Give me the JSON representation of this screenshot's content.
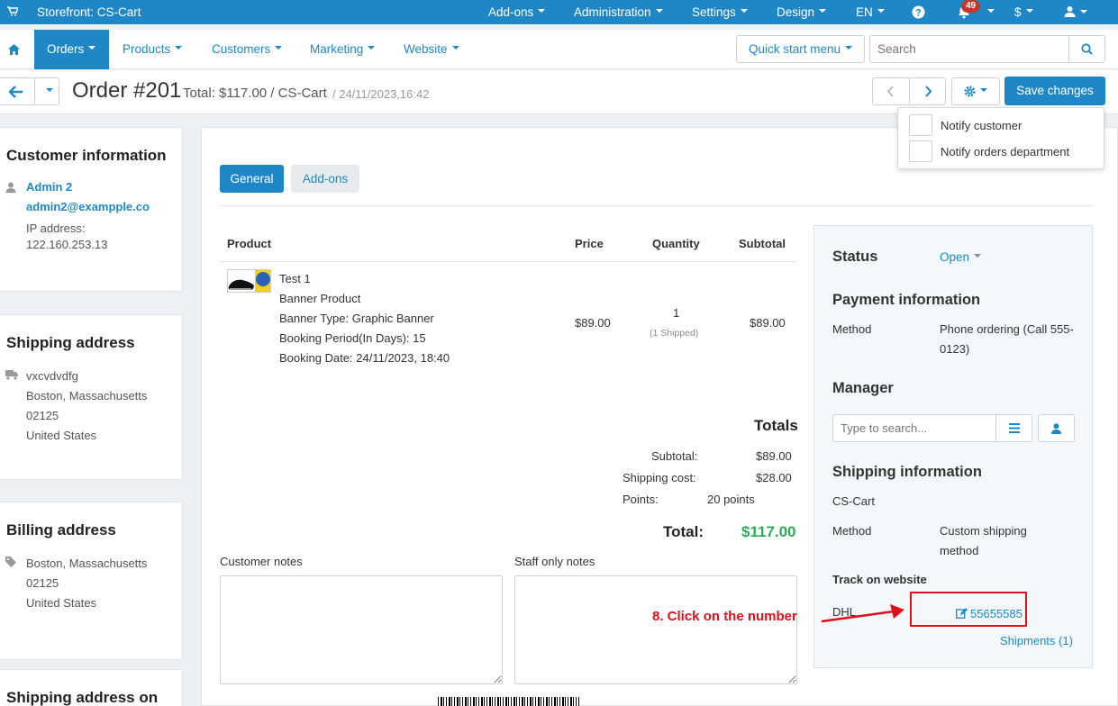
{
  "topbar": {
    "storefront": "Storefront: CS-Cart",
    "addons": "Add-ons",
    "administration": "Administration",
    "settings": "Settings",
    "design": "Design",
    "language": "EN",
    "notification_count": "49",
    "currency": "$"
  },
  "nav": {
    "orders": "Orders",
    "products": "Products",
    "customers": "Customers",
    "marketing": "Marketing",
    "website": "Website",
    "quick_start": "Quick start menu",
    "search_placeholder": "Search"
  },
  "header": {
    "title": "Order #201",
    "total": "Total: $117.00 / CS-Cart",
    "date": "/ 24/11/2023,16:42",
    "save": "Save changes"
  },
  "notify": {
    "customer": "Notify customer",
    "orders_dept": "Notify orders department"
  },
  "customer_info": {
    "heading": "Customer information",
    "name": "Admin 2",
    "email": "admin2@exampple.co",
    "ip_label": "IP address:",
    "ip": "122.160.253.13"
  },
  "shipping_address": {
    "heading": "Shipping address",
    "name": "vxcvdvdfg",
    "city": "Boston, Massachusetts",
    "zip": "02125",
    "country": "United States"
  },
  "billing_address": {
    "heading": "Billing address",
    "city": "Boston, Massachusetts",
    "zip": "02125",
    "country": "United States"
  },
  "shipping_address_on": {
    "heading": "Shipping address on"
  },
  "tabs": {
    "general": "General",
    "addons": "Add-ons"
  },
  "table": {
    "headers": {
      "product": "Product",
      "price": "Price",
      "quantity": "Quantity",
      "subtotal": "Subtotal"
    },
    "row": {
      "name": "Test 1",
      "type": "Banner Product",
      "banner_type": "Banner Type: Graphic Banner",
      "booking_period": "Booking Period(In Days): 15",
      "booking_date": "Booking Date: 24/11/2023, 18:40",
      "price": "$89.00",
      "qty": "1",
      "shipped": "(1 Shipped)",
      "subtotal": "$89.00"
    }
  },
  "totals": {
    "heading": "Totals",
    "subtotal_label": "Subtotal:",
    "subtotal": "$89.00",
    "shipping_label": "Shipping cost:",
    "shipping": "$28.00",
    "points_label": "Points:",
    "points": "20 points",
    "total_label": "Total:",
    "total": "$117.00"
  },
  "notes": {
    "customer": "Customer notes",
    "staff": "Staff only notes"
  },
  "side": {
    "status_label": "Status",
    "status": "Open",
    "payment_heading": "Payment information",
    "method_label": "Method",
    "payment_method": "Phone ordering (Call 555-0123)",
    "manager_heading": "Manager",
    "manager_placeholder": "Type to search...",
    "shipping_heading": "Shipping information",
    "shipping_store": "CS-Cart",
    "shipping_method_label": "Method",
    "shipping_method": "Custom shipping method",
    "track_heading": "Track on website",
    "carrier": "DHL",
    "tracking_number": "55655585",
    "shipments": "Shipments (1)"
  },
  "annotation": {
    "text": "8. Click on the number"
  },
  "colors": {
    "primary": "#1f87c6",
    "link": "#1e88c5",
    "total_green": "#2eab59",
    "annotation_red": "#e0101a",
    "badge_red": "#c0392b"
  }
}
